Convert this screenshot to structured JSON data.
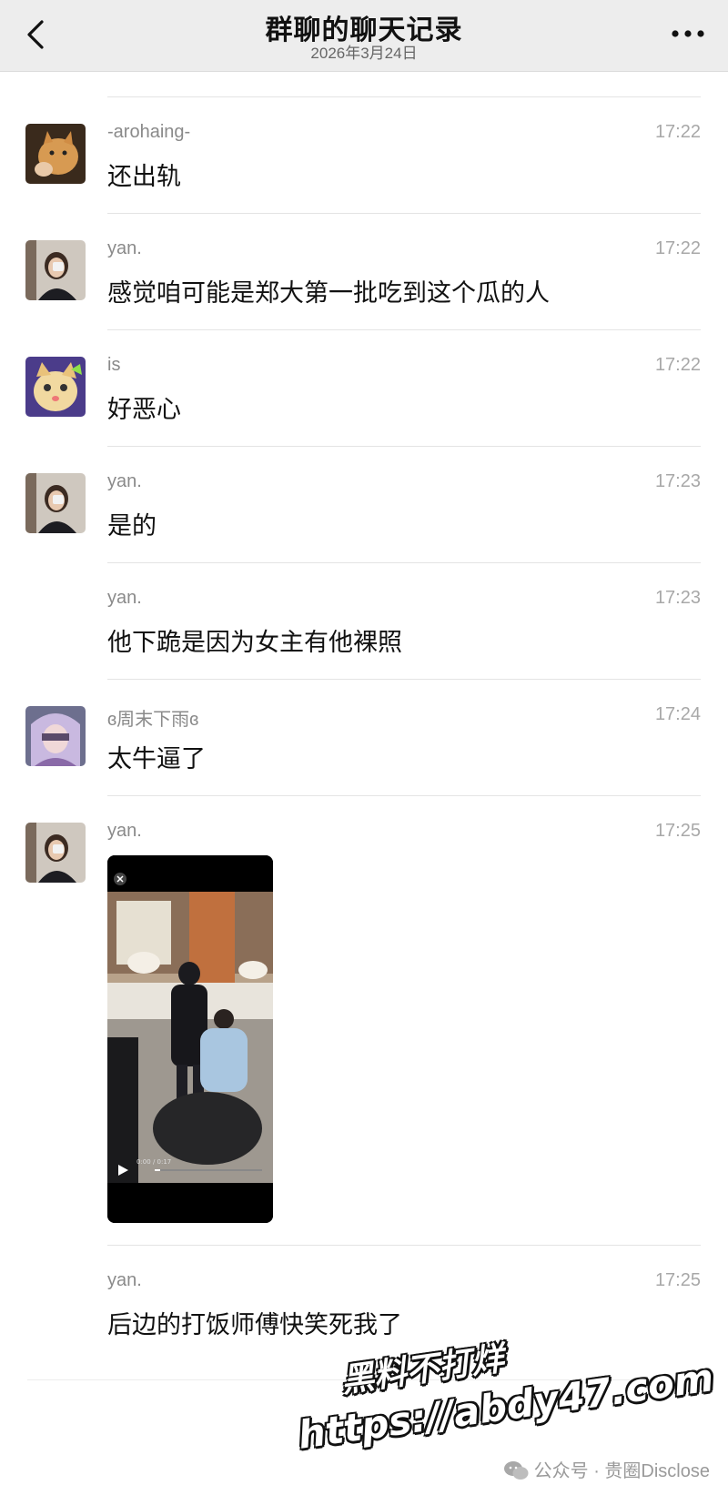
{
  "header": {
    "title": "群聊的聊天记录",
    "date": "2026年3月24日"
  },
  "icons": {
    "back": "chevron-left-icon",
    "more": "more-dots-icon",
    "wechat": "wechat-icon",
    "video_close": "close-icon",
    "video_play": "play-icon"
  },
  "messages": [
    {
      "sender": "-arohaing-",
      "time": "17:22",
      "text": "还出轨"
    },
    {
      "sender": "yan.",
      "time": "17:22",
      "text": "感觉咱可能是郑大第一批吃到这个瓜的人"
    },
    {
      "sender": "is",
      "time": "17:22",
      "text": "好恶心"
    },
    {
      "sender": "yan.",
      "time": "17:23",
      "text": "是的"
    },
    {
      "sender": "yan.",
      "time": "17:23",
      "text": "他下跪是因为女主有他裸照"
    },
    {
      "sender": "ɞ周末下雨ɞ",
      "time": "17:24",
      "text": "太牛逼了"
    },
    {
      "sender": "yan.",
      "time": "17:25",
      "text": ""
    },
    {
      "sender": "yan.",
      "time": "17:25",
      "text": "后边的打饭师傅快笑死我了"
    }
  ],
  "video": {
    "progress_label": "0:00 / 0:17"
  },
  "watermark": {
    "line1": "黑料不打烊",
    "line2": "https://abdy47.com"
  },
  "footer": {
    "source": "公众号 · 贵圈Disclose"
  }
}
